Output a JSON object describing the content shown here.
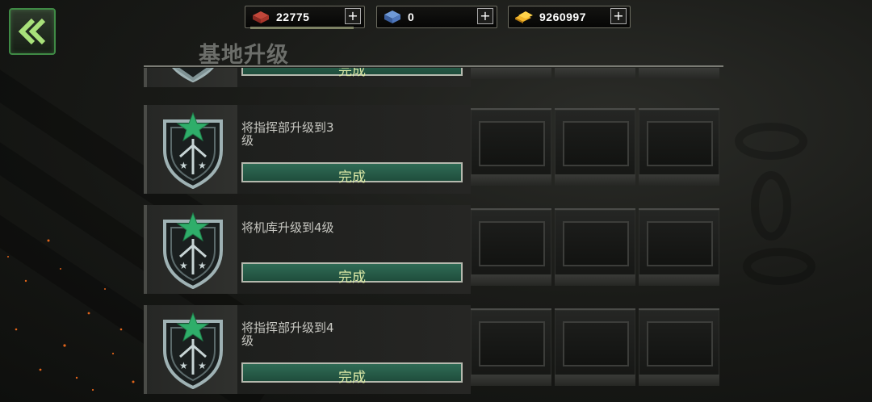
{
  "header": {
    "title": "基地升级"
  },
  "resources": [
    {
      "name": "bricks",
      "icon": "bricks-icon",
      "value": "22775"
    },
    {
      "name": "crates",
      "icon": "crate-icon",
      "value": "0"
    },
    {
      "name": "gold",
      "icon": "gold-bars-icon",
      "value": "9260997"
    }
  ],
  "tasks": [
    {
      "description": "",
      "status": "完成"
    },
    {
      "description": "将指挥部升级到3级",
      "status": "完成"
    },
    {
      "description": "将机库升级到4级",
      "status": "完成"
    },
    {
      "description": "将指挥部升级到4级",
      "status": "完成"
    }
  ],
  "colors": {
    "accent_green": "#3f8a45",
    "complete_bar": "#2f6b55",
    "complete_text": "#dbe8a6"
  }
}
